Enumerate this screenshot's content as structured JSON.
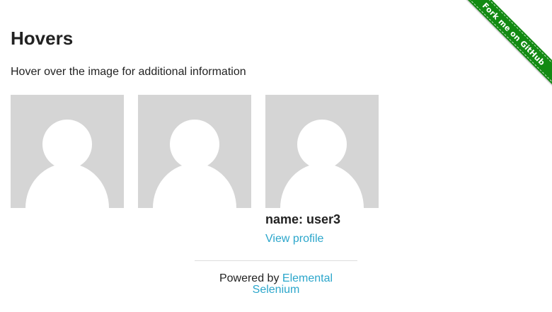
{
  "ribbon": {
    "label": "Fork me on GitHub",
    "color": "#128a12"
  },
  "heading": "Hovers",
  "instructions": "Hover over the image for additional information",
  "avatar_icon": "user-silhouette-icon",
  "avatar_bg": "#d5d5d5",
  "avatar_fg": "#ffffff",
  "figures": [
    {
      "name": "",
      "link": ""
    },
    {
      "name": "",
      "link": ""
    },
    {
      "name": "name: user3",
      "link": "View profile"
    }
  ],
  "footer": {
    "prefix": "Powered by ",
    "link": "Elemental Selenium"
  },
  "link_color": "#2ba6cb"
}
